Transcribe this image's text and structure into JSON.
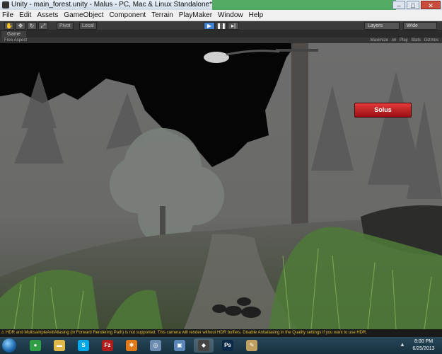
{
  "window": {
    "title": "Unity - main_forest.unity - Malus - PC, Mac & Linux Standalone*",
    "buttons": {
      "minimize": "–",
      "maximize": "□",
      "close": "✕"
    }
  },
  "menu": [
    "File",
    "Edit",
    "Assets",
    "GameObject",
    "Component",
    "Terrain",
    "PlayMaker",
    "Window",
    "Help"
  ],
  "toolbar": {
    "pivot": "Pivot",
    "space": "Local",
    "layers": "Layers",
    "layout": "Wide"
  },
  "game_view": {
    "tab": "Game",
    "aspect": "Free Aspect",
    "right_controls": "Maximize on Play  Stats  Gizmos"
  },
  "hud": {
    "button": "Solus"
  },
  "status": {
    "message": "HDR and MultisampleAntiAliasing (in Forward Rendering Path) is not supported. This camera will render without HDR buffers. Disable Antialiasing in the Quality settings if you want to use HDR."
  },
  "taskbar": {
    "apps": [
      {
        "name": "chrome",
        "glyph": "●",
        "color": "#2f9e44"
      },
      {
        "name": "explorer",
        "glyph": "▬",
        "color": "#e0b84a"
      },
      {
        "name": "skype",
        "glyph": "S",
        "color": "#00a8e8"
      },
      {
        "name": "filezilla",
        "glyph": "Fz",
        "color": "#b01c1c"
      },
      {
        "name": "settings",
        "glyph": "✱",
        "color": "#e07a18"
      },
      {
        "name": "network",
        "glyph": "◎",
        "color": "#6c8cb0"
      },
      {
        "name": "image-viewer",
        "glyph": "▣",
        "color": "#5a86b8"
      },
      {
        "name": "unity",
        "glyph": "◆",
        "color": "#444"
      },
      {
        "name": "photoshop",
        "glyph": "Ps",
        "color": "#0b2a4a"
      },
      {
        "name": "paint",
        "glyph": "✎",
        "color": "#c0a060"
      }
    ],
    "time": "8:00 PM",
    "date": "6/25/2013"
  }
}
